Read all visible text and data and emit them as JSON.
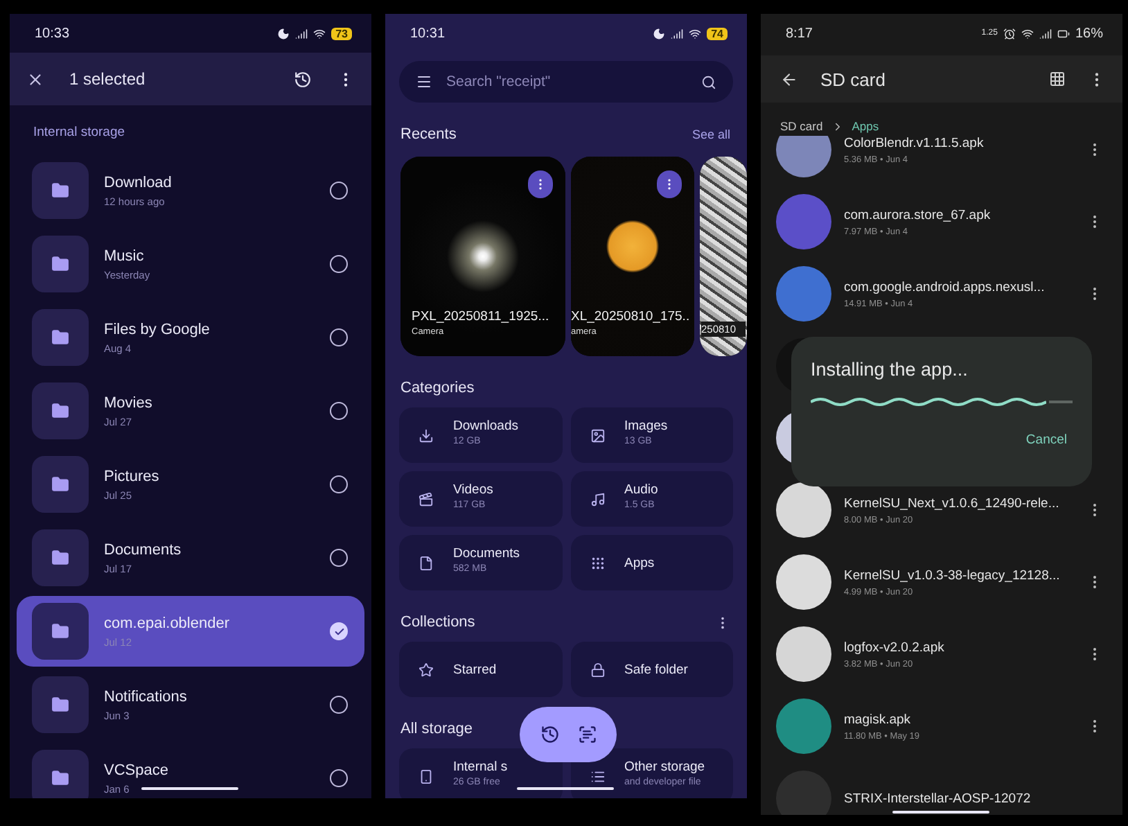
{
  "phones": [
    {
      "kind": "files_selection",
      "status": {
        "time": "10:33",
        "battery": "73"
      },
      "toolbar": {
        "title": "1 selected"
      },
      "section": "Internal storage",
      "folders": [
        {
          "name": "Download",
          "date": "12 hours ago",
          "selected": false
        },
        {
          "name": "Music",
          "date": "Yesterday",
          "selected": false
        },
        {
          "name": "Files by Google",
          "date": "Aug 4",
          "selected": false
        },
        {
          "name": "Movies",
          "date": "Jul 27",
          "selected": false
        },
        {
          "name": "Pictures",
          "date": "Jul 25",
          "selected": false
        },
        {
          "name": "Documents",
          "date": "Jul 17",
          "selected": false
        },
        {
          "name": "com.epai.oblender",
          "date": "Jul 12",
          "selected": true
        },
        {
          "name": "Notifications",
          "date": "Jun 3",
          "selected": false
        },
        {
          "name": "VCSpace",
          "date": "Jan 6",
          "selected": false
        }
      ]
    },
    {
      "kind": "files_home",
      "status": {
        "time": "10:31",
        "battery": "74"
      },
      "search": {
        "placeholder": "Search \"receipt\""
      },
      "recents": {
        "title": "Recents",
        "link": "See all",
        "cards": [
          {
            "name": "PXL_20250811_1925...",
            "source": "Camera",
            "kind": "star"
          },
          {
            "name": "XL_20250810_175..",
            "source": "amera",
            "kind": "moon"
          },
          {
            "name": "250810",
            "kind": "texture"
          }
        ]
      },
      "categories": {
        "title": "Categories",
        "tiles": [
          {
            "kind": "downloads",
            "name": "Downloads",
            "size": "12 GB"
          },
          {
            "kind": "images",
            "name": "Images",
            "size": "13 GB"
          },
          {
            "kind": "videos",
            "name": "Videos",
            "size": "117 GB"
          },
          {
            "kind": "audio",
            "name": "Audio",
            "size": "1.5 GB"
          },
          {
            "kind": "documents",
            "name": "Documents",
            "size": "582 MB"
          },
          {
            "kind": "apps",
            "name": "Apps"
          }
        ]
      },
      "collections": {
        "title": "Collections",
        "tiles": [
          {
            "kind": "starred",
            "name": "Starred"
          },
          {
            "kind": "safe",
            "name": "Safe folder"
          }
        ]
      },
      "storage": {
        "title": "All storage",
        "tiles": [
          {
            "kind": "phone",
            "name": "Internal s",
            "size": "26 GB free"
          },
          {
            "kind": "other",
            "name": "Other storage",
            "size": "and developer file"
          }
        ]
      }
    },
    {
      "kind": "sd_card",
      "status": {
        "time": "8:17",
        "speed": "1.25",
        "battery": "16%"
      },
      "toolbar": {
        "title": "SD card"
      },
      "breadcrumb": [
        "SD card",
        "Apps"
      ],
      "apps": [
        {
          "name": "ColorBlendr.v1.11.5.apk",
          "meta": "5.36 MB • Jun 4",
          "color": "#7d86b8"
        },
        {
          "name": "com.aurora.store_67.apk",
          "meta": "7.97 MB • Jun 4",
          "color": "#5b4fc8"
        },
        {
          "name": "com.google.android.apps.nexusl...",
          "meta": "14.91 MB • Jun 4",
          "color": "#3f6fd0"
        },
        {
          "color": "#111111"
        },
        {
          "color": "#c9cbe0"
        },
        {
          "name": "KernelSU_Next_v1.0.6_12490-rele...",
          "meta": "8.00 MB • Jun 20",
          "color": "#d8d8d8"
        },
        {
          "name": "KernelSU_v1.0.3-38-legacy_12128...",
          "meta": "4.99 MB • Jun 20",
          "color": "#dcdcdc"
        },
        {
          "name": "logfox-v2.0.2.apk",
          "meta": "3.82 MB • Jun 20",
          "color": "#d6d6d6"
        },
        {
          "name": "magisk.apk",
          "meta": "11.80 MB • May 19",
          "color": "#1f8d83"
        },
        {
          "name": "STRIX-Interstellar-AOSP-12072",
          "color": "#2e2e2e"
        }
      ],
      "dialog": {
        "title": "Installing the app...",
        "level": 0.9,
        "button": "Cancel"
      }
    }
  ]
}
